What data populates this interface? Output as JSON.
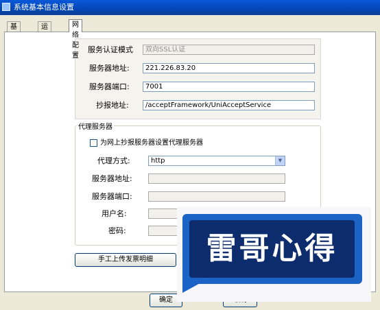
{
  "window": {
    "title": "系统基本信息设置"
  },
  "tabs": [
    {
      "label": "基本信息"
    },
    {
      "label": "运行参数"
    },
    {
      "label": "网络配置"
    }
  ],
  "server": {
    "auth_mode_label": "服务认证模式",
    "auth_mode_value": "双向SSL认证",
    "address_label": "服务器地址:",
    "address_value": "221.226.83.20",
    "port_label": "服务器端口:",
    "port_value": "7001",
    "report_label": "抄报地址:",
    "report_value": "/acceptFramework/UniAcceptService"
  },
  "proxy": {
    "group_label": "代理服务器",
    "checkbox_label": "为网上抄报服务器设置代理服务器",
    "mode_label": "代理方式:",
    "mode_value": "http",
    "address_label": "服务器地址:",
    "port_label": "服务器端口:",
    "user_label": "用户名:",
    "password_label": "密码:"
  },
  "buttons": {
    "upload": "手工上传发票明细",
    "ok": "确定",
    "cancel": "取消"
  },
  "watermark": {
    "text": "雷哥心得"
  }
}
